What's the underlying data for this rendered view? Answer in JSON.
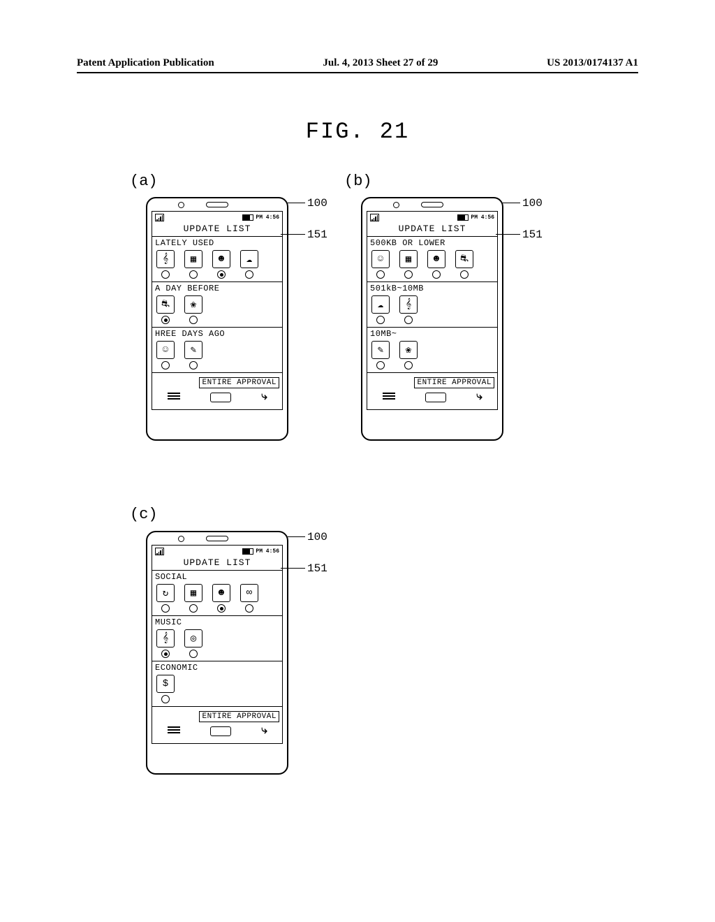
{
  "header": {
    "left": "Patent Application Publication",
    "center": "Jul. 4, 2013   Sheet 27 of 29",
    "right": "US 2013/0174137 A1"
  },
  "figure_title": "FIG. 21",
  "status": {
    "signal": "Y.ull",
    "time": "PM 4:56"
  },
  "title": "UPDATE LIST",
  "approval_label": "ENTIRE APPROVAL",
  "refs": {
    "phone": "100",
    "screen": "151"
  },
  "panels": {
    "a": {
      "label": "(a)",
      "groups": [
        {
          "title": "LATELY USED",
          "apps": [
            {
              "icon": "music-note",
              "sel": false
            },
            {
              "icon": "calendar",
              "sel": false
            },
            {
              "icon": "chat",
              "sel": true
            },
            {
              "icon": "cloud",
              "sel": false
            }
          ]
        },
        {
          "title": "A DAY BEFORE",
          "apps": [
            {
              "icon": "car",
              "sel": true
            },
            {
              "icon": "contacts",
              "sel": false
            }
          ]
        },
        {
          "title": "HREE DAYS AGO",
          "apps": [
            {
              "icon": "person",
              "sel": false
            },
            {
              "icon": "pencil",
              "sel": false
            }
          ]
        }
      ]
    },
    "b": {
      "label": "(b)",
      "groups": [
        {
          "title": "500KB OR LOWER",
          "apps": [
            {
              "icon": "person",
              "sel": false
            },
            {
              "icon": "calendar",
              "sel": false
            },
            {
              "icon": "chat",
              "sel": false
            },
            {
              "icon": "car",
              "sel": false
            }
          ]
        },
        {
          "title": "501kB~10MB",
          "apps": [
            {
              "icon": "cloud",
              "sel": false
            },
            {
              "icon": "music-note",
              "sel": false
            }
          ]
        },
        {
          "title": "10MB~",
          "apps": [
            {
              "icon": "pencil",
              "sel": false
            },
            {
              "icon": "contacts",
              "sel": false
            }
          ]
        }
      ]
    },
    "c": {
      "label": "(c)",
      "groups": [
        {
          "title": "SOCIAL",
          "apps": [
            {
              "icon": "share",
              "sel": false
            },
            {
              "icon": "calendar",
              "sel": false
            },
            {
              "icon": "chat",
              "sel": true
            },
            {
              "icon": "people",
              "sel": false
            }
          ]
        },
        {
          "title": "MUSIC",
          "apps": [
            {
              "icon": "music-note",
              "sel": true
            },
            {
              "icon": "disc",
              "sel": false
            }
          ]
        },
        {
          "title": "ECONOMIC",
          "apps": [
            {
              "icon": "money",
              "sel": false
            }
          ]
        }
      ]
    }
  }
}
